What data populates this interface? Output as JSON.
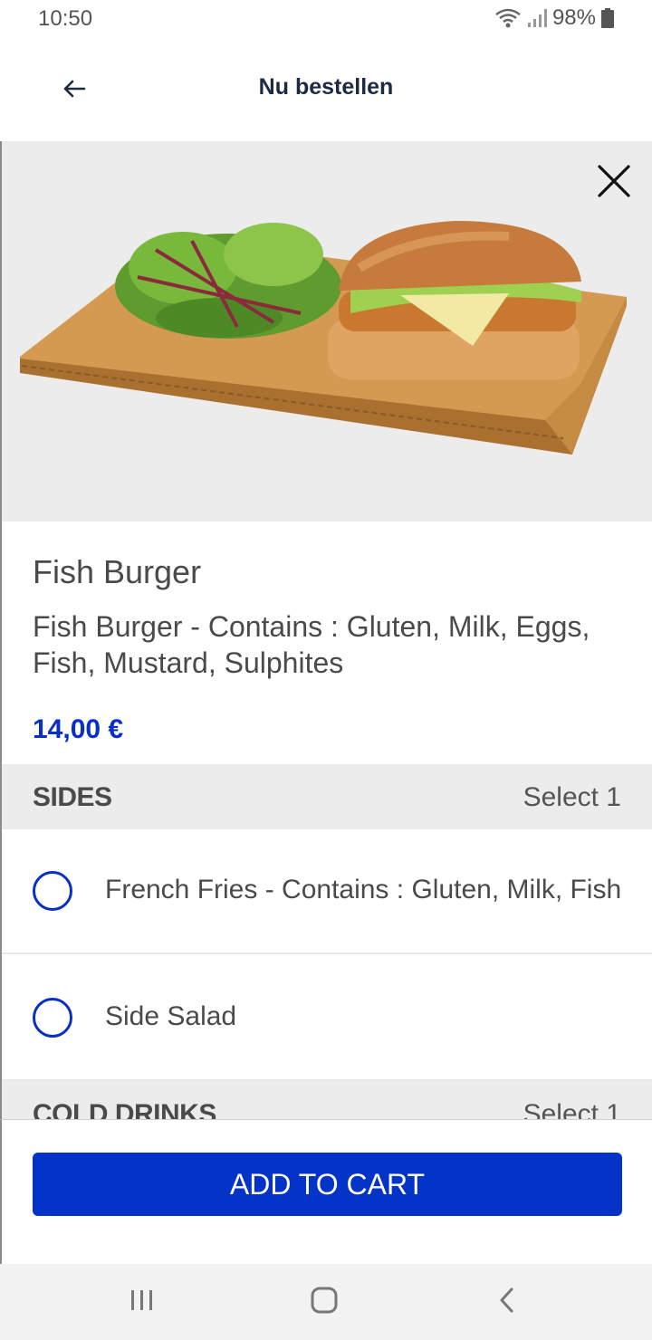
{
  "status": {
    "time": "10:50",
    "battery": "98%"
  },
  "header": {
    "title": "Nu bestellen",
    "back_icon": "arrow-left-icon"
  },
  "product": {
    "name": "Fish Burger",
    "description": "Fish Burger - Contains : Gluten, Milk, Eggs, Fish, Mustard, Sulphites",
    "price": "14,00 €"
  },
  "groups": [
    {
      "title": "SIDES",
      "rule": "Select 1",
      "options": [
        {
          "label": "French Fries - Contains : Gluten, Milk, Fish",
          "selected": false
        },
        {
          "label": "Side Salad",
          "selected": false
        }
      ]
    },
    {
      "title": "COLD DRINKS",
      "rule": "Select 1"
    }
  ],
  "cta": {
    "label": "ADD TO CART"
  },
  "colors": {
    "accent": "#0433c8",
    "price": "#0a2fc4",
    "section_bg": "#ececec"
  }
}
